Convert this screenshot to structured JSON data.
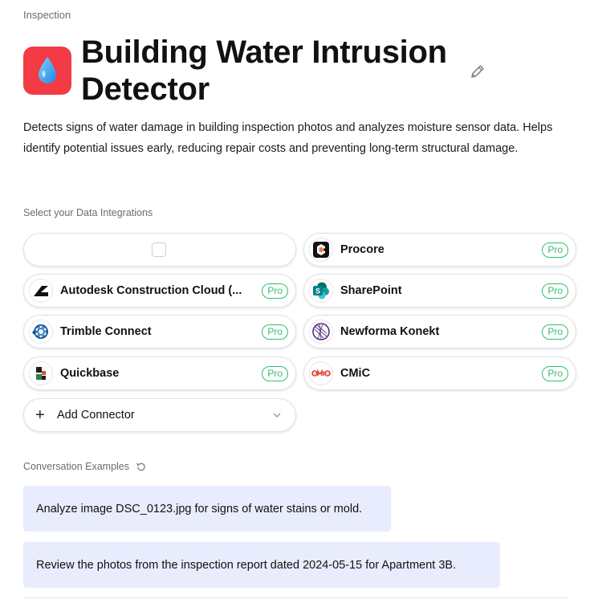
{
  "category": "Inspection",
  "app": {
    "icon": "water-droplet-icon",
    "icon_bg": "#f23b45",
    "title": "Building Water Intrusion Detector",
    "description": "Detects signs of water damage in building inspection photos and analyzes moisture sensor data. Helps identify potential issues early, reducing repair costs and preventing long-term structural damage."
  },
  "integrations": {
    "label": "Select your Data Integrations",
    "badge_label": "Pro",
    "badge_color": "#2fbf6b",
    "items": [
      {
        "name": "Procore",
        "icon": "procore-logo-icon",
        "pro": true
      },
      {
        "name": "Autodesk Construction Cloud (...",
        "icon": "autodesk-logo-icon",
        "pro": true
      },
      {
        "name": "SharePoint",
        "icon": "sharepoint-logo-icon",
        "pro": true
      },
      {
        "name": "Trimble Connect",
        "icon": "trimble-logo-icon",
        "pro": true
      },
      {
        "name": "Newforma Konekt",
        "icon": "newforma-logo-icon",
        "pro": true
      },
      {
        "name": "Quickbase",
        "icon": "quickbase-logo-icon",
        "pro": true
      },
      {
        "name": "CMiC",
        "icon": "cmic-logo-icon",
        "pro": true
      }
    ],
    "add_connector_label": "Add Connector"
  },
  "examples": {
    "label": "Conversation Examples",
    "items": [
      "Analyze image DSC_0123.jpg for signs of water stains or mold.",
      "Review the photos from the inspection report dated 2024-05-15 for Apartment 3B."
    ]
  }
}
